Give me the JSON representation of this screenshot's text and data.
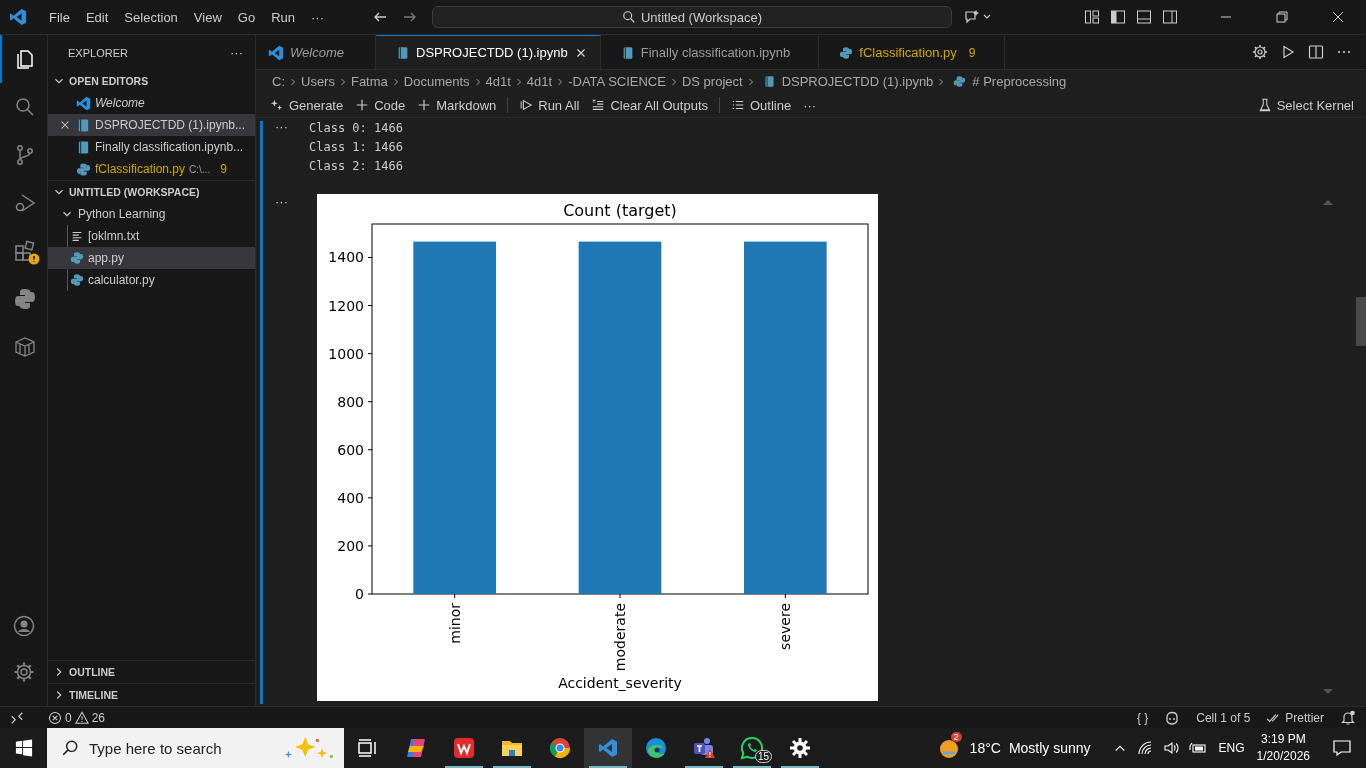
{
  "titlebar": {
    "menus": [
      "File",
      "Edit",
      "Selection",
      "View",
      "Go",
      "Run",
      "···"
    ],
    "search": "Untitled (Workspace)"
  },
  "activity_bar": [
    {
      "kind": "files",
      "selected": true
    },
    {
      "kind": "search",
      "selected": false
    },
    {
      "kind": "source-control",
      "selected": false
    },
    {
      "kind": "run-debug",
      "selected": false
    },
    {
      "kind": "extensions",
      "selected": false,
      "warning": true
    },
    {
      "kind": "python",
      "selected": false
    },
    {
      "kind": "box",
      "selected": false
    }
  ],
  "sidebar": {
    "title": "EXPLORER",
    "more": "···",
    "open_editors": {
      "title": "OPEN EDITORS",
      "expanded": true,
      "items": [
        {
          "label": "Welcome",
          "kind": "vscode",
          "preview": true,
          "selected": false
        },
        {
          "label": "DSPROJECTDD (1).ipynb...",
          "kind": "notebook",
          "preview": false,
          "selected": true
        },
        {
          "label": "Finally classification.ipynb...",
          "kind": "notebook",
          "preview": false,
          "selected": false
        },
        {
          "label": "fClassification.py",
          "kind": "python",
          "preview": false,
          "selected": false,
          "warning": true,
          "description": "C:\\...",
          "problems": "9"
        }
      ]
    },
    "workspace": {
      "title": "UNTITLED (WORKSPACE)",
      "expanded": true,
      "children": [
        {
          "label": "Python Learning",
          "expanded": true,
          "children": [
            {
              "label": "[oklmn.txt",
              "kind": "text",
              "selected": false
            },
            {
              "label": "app.py",
              "kind": "python",
              "selected": true
            },
            {
              "label": "calculator.py",
              "kind": "python",
              "selected": false
            }
          ]
        }
      ]
    },
    "sections": [
      {
        "title": "OUTLINE",
        "expanded": false
      },
      {
        "title": "TIMELINE",
        "expanded": false
      }
    ]
  },
  "tabs": [
    {
      "label": "Welcome",
      "kind": "vscode",
      "preview": true,
      "selected": false
    },
    {
      "label": "DSPROJECTDD (1).ipynb",
      "kind": "notebook",
      "preview": false,
      "selected": true
    },
    {
      "label": "Finally classification.ipynb",
      "kind": "notebook",
      "preview": false,
      "selected": false
    },
    {
      "label": "fClassification.py",
      "kind": "python",
      "preview": false,
      "selected": false,
      "warning": true,
      "problems": "9"
    }
  ],
  "breadcrumbs": [
    {
      "label": "C:",
      "kind": "folder"
    },
    {
      "label": "Users",
      "kind": "folder"
    },
    {
      "label": "Fatma",
      "kind": "folder"
    },
    {
      "label": "Documents",
      "kind": "folder"
    },
    {
      "label": "4d1t",
      "kind": "folder"
    },
    {
      "label": "4d1t",
      "kind": "folder"
    },
    {
      "label": "-DATA SCIENCE",
      "kind": "folder"
    },
    {
      "label": "DS project",
      "kind": "folder"
    },
    {
      "label": "DSPROJECTDD (1).ipynb",
      "kind": "notebook"
    },
    {
      "label": "# Preprocessing",
      "kind": "python"
    }
  ],
  "toolbar": [
    {
      "label": "Generate",
      "kind": "sparkle"
    },
    {
      "label": "Code",
      "kind": "plus"
    },
    {
      "label": "Markdown",
      "kind": "plus"
    },
    {
      "kind": "separator"
    },
    {
      "label": "Run All",
      "kind": "run"
    },
    {
      "label": "Clear All Outputs",
      "kind": "clear"
    },
    {
      "kind": "separator"
    },
    {
      "label": "Outline",
      "kind": "list"
    },
    {
      "label": "···",
      "kind": "more"
    }
  ],
  "kernel": "Select Kernel",
  "cells": [
    {
      "more": "···",
      "output": [
        "Class 0: 1466",
        "Class 1: 1466",
        "Class 2: 1466"
      ]
    },
    {
      "more": "···",
      "chart_data": {
        "type": "bar",
        "title": "Count (target)",
        "xlabel": "Accident_severity",
        "categories": [
          "minor",
          "moderate",
          "severe"
        ],
        "values": [
          1466,
          1466,
          1466
        ],
        "ylim": [
          0,
          1539.3
        ],
        "yticks": [
          0,
          200,
          400,
          600,
          800,
          1000,
          1200,
          1400
        ]
      }
    }
  ],
  "status_bar": {
    "errors": "0",
    "warnings": "26",
    "braces": "{ }",
    "cell": "Cell 1 of 5",
    "formatter": "Prettier"
  },
  "taskbar": {
    "search": "Type here to search",
    "apps": [
      {
        "kind": "task-view",
        "running": false
      },
      {
        "kind": "copilot",
        "running": false
      },
      {
        "kind": "wps",
        "running": true
      },
      {
        "kind": "folder",
        "running": true
      },
      {
        "kind": "chrome",
        "running": false
      },
      {
        "kind": "vscode",
        "running": true,
        "selected": true
      },
      {
        "kind": "edge",
        "running": false
      },
      {
        "kind": "teams",
        "running": true
      },
      {
        "kind": "whatsapp",
        "running": true,
        "badge": "15"
      },
      {
        "kind": "settings",
        "running": true
      }
    ],
    "weather": {
      "badge": "2",
      "temp": "18°C",
      "text": "Mostly sunny"
    },
    "lang": "ENG",
    "time": "3:19 PM",
    "date": "1/20/2026"
  }
}
